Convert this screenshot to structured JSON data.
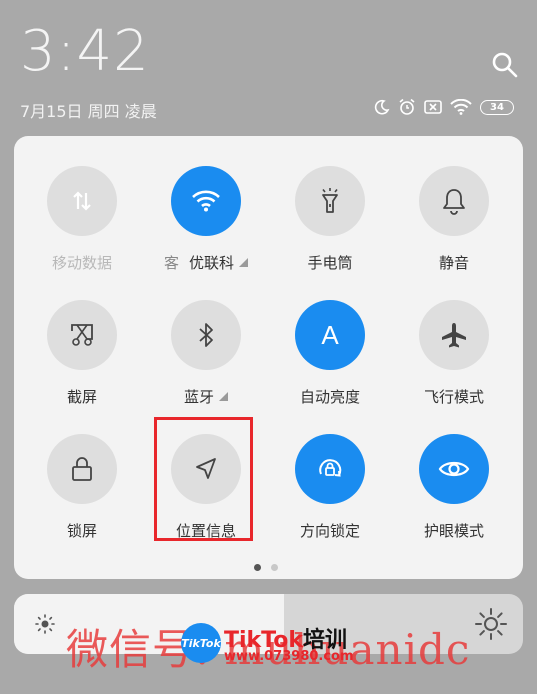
{
  "status": {
    "time": "3:42",
    "date": "7月15日 周四 凌晨",
    "battery": "34"
  },
  "tiles": [
    {
      "label": "移动数据",
      "state": "off",
      "icon": "mobile-data-icon"
    },
    {
      "label": "优联科",
      "prefix": "客",
      "state": "on",
      "icon": "wifi-icon"
    },
    {
      "label": "手电筒",
      "state": "off",
      "icon": "flashlight-icon"
    },
    {
      "label": "静音",
      "state": "off",
      "icon": "bell-icon"
    },
    {
      "label": "截屏",
      "state": "off",
      "icon": "screenshot-icon"
    },
    {
      "label": "蓝牙",
      "state": "off",
      "icon": "bluetooth-icon"
    },
    {
      "label": "自动亮度",
      "state": "on",
      "icon": "auto-brightness-icon"
    },
    {
      "label": "飞行模式",
      "state": "off",
      "icon": "airplane-icon"
    },
    {
      "label": "锁屏",
      "state": "off",
      "icon": "lock-icon"
    },
    {
      "label": "位置信息",
      "state": "off",
      "icon": "location-icon"
    },
    {
      "label": "方向锁定",
      "state": "on",
      "icon": "rotation-lock-icon"
    },
    {
      "label": "护眼模式",
      "state": "on",
      "icon": "eye-icon"
    }
  ],
  "auto_brightness_glyph": "A",
  "pager": {
    "pages": 2,
    "current": 1
  },
  "brightness": {
    "level": 0.53
  },
  "watermark": {
    "text": "微信号: muhuanidc",
    "logo_text": "TikTok",
    "brand": "TikTok",
    "brand_cn": "培训",
    "url": "www.073980.com"
  },
  "colors": {
    "accent": "#1a8cf0",
    "highlight": "#e8262b"
  }
}
